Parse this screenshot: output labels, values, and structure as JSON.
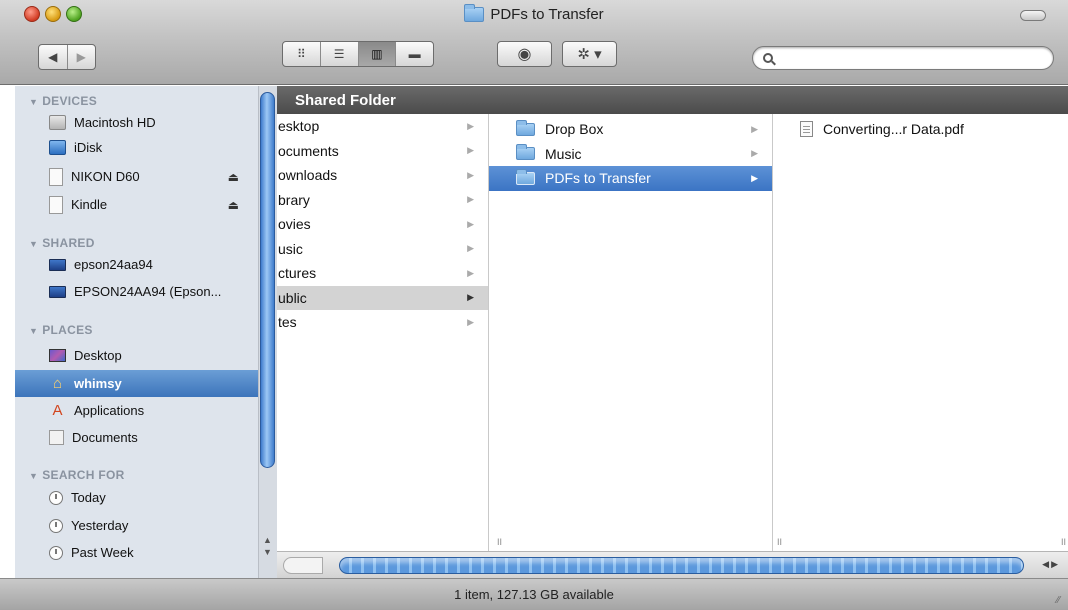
{
  "window": {
    "title": "PDFs to Transfer"
  },
  "toolbar": {
    "back_icon": "back-arrow",
    "forward_icon": "forward-arrow",
    "view_modes": [
      "icon",
      "list",
      "column",
      "cover-flow"
    ],
    "active_view": "column",
    "quicklook_icon": "eye",
    "action_icon": "gear",
    "search": {
      "value": "",
      "placeholder": ""
    }
  },
  "sidebar": {
    "sections": {
      "devices": "DEVICES",
      "shared": "SHARED",
      "places": "PLACES",
      "search_for": "SEARCH FOR"
    },
    "devices": [
      {
        "label": "Macintosh HD",
        "icon": "hard-drive"
      },
      {
        "label": "iDisk",
        "icon": "idisk"
      },
      {
        "label": "NIKON D60",
        "icon": "removable-drive",
        "eject": "⏏"
      },
      {
        "label": "Kindle",
        "icon": "removable-drive",
        "eject": "⏏"
      }
    ],
    "shared": [
      {
        "label": "epson24aa94",
        "icon": "monitor"
      },
      {
        "label": "EPSON24AA94 (Epson...",
        "icon": "monitor"
      }
    ],
    "places": [
      {
        "label": "Desktop",
        "icon": "desktop"
      },
      {
        "label": "whimsy",
        "icon": "home",
        "selected": true
      },
      {
        "label": "Applications",
        "icon": "applications"
      },
      {
        "label": "Documents",
        "icon": "documents"
      }
    ],
    "search_for": [
      {
        "label": "Today",
        "icon": "clock"
      },
      {
        "label": "Yesterday",
        "icon": "clock"
      },
      {
        "label": "Past Week",
        "icon": "clock"
      }
    ]
  },
  "path_bar": {
    "label": "Shared Folder"
  },
  "columns": {
    "col1": [
      {
        "label": "esktop"
      },
      {
        "label": "ocuments"
      },
      {
        "label": "ownloads"
      },
      {
        "label": "brary"
      },
      {
        "label": "ovies"
      },
      {
        "label": "usic"
      },
      {
        "label": "ctures"
      },
      {
        "label": "ublic",
        "selected": true
      },
      {
        "label": "tes"
      }
    ],
    "col2": [
      {
        "label": "Drop Box"
      },
      {
        "label": "Music"
      },
      {
        "label": "PDFs to Transfer",
        "selected": true
      }
    ],
    "col3": [
      {
        "label": "Converting...r Data.pdf"
      }
    ]
  },
  "status": {
    "text": "1 item, 127.13 GB available"
  },
  "colors": {
    "selection_blue": "#3b74c4",
    "sidebar_bg": "#dee4ec",
    "path_bar_bg": "#4b4b4b"
  }
}
